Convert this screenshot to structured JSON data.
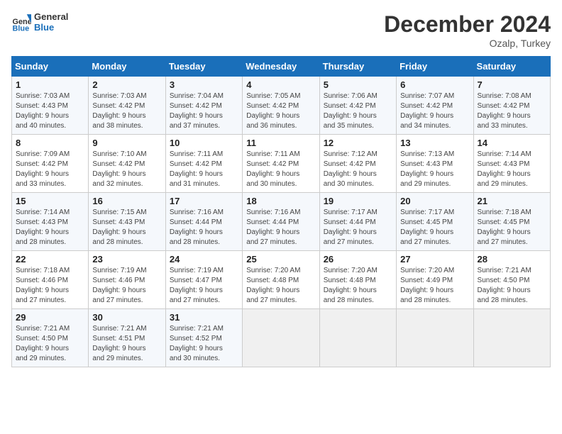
{
  "header": {
    "logo_line1": "General",
    "logo_line2": "Blue",
    "month": "December 2024",
    "location": "Ozalp, Turkey"
  },
  "days_of_week": [
    "Sunday",
    "Monday",
    "Tuesday",
    "Wednesday",
    "Thursday",
    "Friday",
    "Saturday"
  ],
  "weeks": [
    [
      {
        "day": "1",
        "info": "Sunrise: 7:03 AM\nSunset: 4:43 PM\nDaylight: 9 hours\nand 40 minutes."
      },
      {
        "day": "2",
        "info": "Sunrise: 7:03 AM\nSunset: 4:42 PM\nDaylight: 9 hours\nand 38 minutes."
      },
      {
        "day": "3",
        "info": "Sunrise: 7:04 AM\nSunset: 4:42 PM\nDaylight: 9 hours\nand 37 minutes."
      },
      {
        "day": "4",
        "info": "Sunrise: 7:05 AM\nSunset: 4:42 PM\nDaylight: 9 hours\nand 36 minutes."
      },
      {
        "day": "5",
        "info": "Sunrise: 7:06 AM\nSunset: 4:42 PM\nDaylight: 9 hours\nand 35 minutes."
      },
      {
        "day": "6",
        "info": "Sunrise: 7:07 AM\nSunset: 4:42 PM\nDaylight: 9 hours\nand 34 minutes."
      },
      {
        "day": "7",
        "info": "Sunrise: 7:08 AM\nSunset: 4:42 PM\nDaylight: 9 hours\nand 33 minutes."
      }
    ],
    [
      {
        "day": "8",
        "info": "Sunrise: 7:09 AM\nSunset: 4:42 PM\nDaylight: 9 hours\nand 33 minutes."
      },
      {
        "day": "9",
        "info": "Sunrise: 7:10 AM\nSunset: 4:42 PM\nDaylight: 9 hours\nand 32 minutes."
      },
      {
        "day": "10",
        "info": "Sunrise: 7:11 AM\nSunset: 4:42 PM\nDaylight: 9 hours\nand 31 minutes."
      },
      {
        "day": "11",
        "info": "Sunrise: 7:11 AM\nSunset: 4:42 PM\nDaylight: 9 hours\nand 30 minutes."
      },
      {
        "day": "12",
        "info": "Sunrise: 7:12 AM\nSunset: 4:42 PM\nDaylight: 9 hours\nand 30 minutes."
      },
      {
        "day": "13",
        "info": "Sunrise: 7:13 AM\nSunset: 4:43 PM\nDaylight: 9 hours\nand 29 minutes."
      },
      {
        "day": "14",
        "info": "Sunrise: 7:14 AM\nSunset: 4:43 PM\nDaylight: 9 hours\nand 29 minutes."
      }
    ],
    [
      {
        "day": "15",
        "info": "Sunrise: 7:14 AM\nSunset: 4:43 PM\nDaylight: 9 hours\nand 28 minutes."
      },
      {
        "day": "16",
        "info": "Sunrise: 7:15 AM\nSunset: 4:43 PM\nDaylight: 9 hours\nand 28 minutes."
      },
      {
        "day": "17",
        "info": "Sunrise: 7:16 AM\nSunset: 4:44 PM\nDaylight: 9 hours\nand 28 minutes."
      },
      {
        "day": "18",
        "info": "Sunrise: 7:16 AM\nSunset: 4:44 PM\nDaylight: 9 hours\nand 27 minutes."
      },
      {
        "day": "19",
        "info": "Sunrise: 7:17 AM\nSunset: 4:44 PM\nDaylight: 9 hours\nand 27 minutes."
      },
      {
        "day": "20",
        "info": "Sunrise: 7:17 AM\nSunset: 4:45 PM\nDaylight: 9 hours\nand 27 minutes."
      },
      {
        "day": "21",
        "info": "Sunrise: 7:18 AM\nSunset: 4:45 PM\nDaylight: 9 hours\nand 27 minutes."
      }
    ],
    [
      {
        "day": "22",
        "info": "Sunrise: 7:18 AM\nSunset: 4:46 PM\nDaylight: 9 hours\nand 27 minutes."
      },
      {
        "day": "23",
        "info": "Sunrise: 7:19 AM\nSunset: 4:46 PM\nDaylight: 9 hours\nand 27 minutes."
      },
      {
        "day": "24",
        "info": "Sunrise: 7:19 AM\nSunset: 4:47 PM\nDaylight: 9 hours\nand 27 minutes."
      },
      {
        "day": "25",
        "info": "Sunrise: 7:20 AM\nSunset: 4:48 PM\nDaylight: 9 hours\nand 27 minutes."
      },
      {
        "day": "26",
        "info": "Sunrise: 7:20 AM\nSunset: 4:48 PM\nDaylight: 9 hours\nand 28 minutes."
      },
      {
        "day": "27",
        "info": "Sunrise: 7:20 AM\nSunset: 4:49 PM\nDaylight: 9 hours\nand 28 minutes."
      },
      {
        "day": "28",
        "info": "Sunrise: 7:21 AM\nSunset: 4:50 PM\nDaylight: 9 hours\nand 28 minutes."
      }
    ],
    [
      {
        "day": "29",
        "info": "Sunrise: 7:21 AM\nSunset: 4:50 PM\nDaylight: 9 hours\nand 29 minutes."
      },
      {
        "day": "30",
        "info": "Sunrise: 7:21 AM\nSunset: 4:51 PM\nDaylight: 9 hours\nand 29 minutes."
      },
      {
        "day": "31",
        "info": "Sunrise: 7:21 AM\nSunset: 4:52 PM\nDaylight: 9 hours\nand 30 minutes."
      },
      {
        "day": "",
        "info": ""
      },
      {
        "day": "",
        "info": ""
      },
      {
        "day": "",
        "info": ""
      },
      {
        "day": "",
        "info": ""
      }
    ]
  ]
}
